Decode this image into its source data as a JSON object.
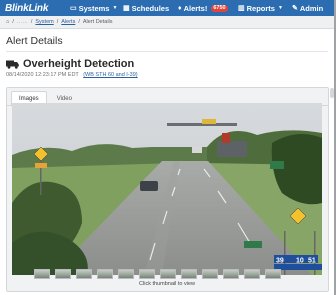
{
  "nav": {
    "brand": "BlinkLink",
    "systems": "Systems",
    "schedules": "Schedules",
    "alerts": "Alerts!",
    "alerts_count": "6750",
    "reports": "Reports",
    "admin": "Admin"
  },
  "breadcrumb": {
    "home": "⌂",
    "sep": "/",
    "system": "System",
    "alerts": "Alerts",
    "current": "Alert Details"
  },
  "page": {
    "title": "Alert Details"
  },
  "alert": {
    "title": "Overheight Detection",
    "timestamp": "08/14/2020 12:23:17 PM EDT",
    "location": "(WB STH 60 and I-39)"
  },
  "tabs": {
    "images": "Images",
    "video": "Video"
  },
  "signs": {
    "route_39": "39",
    "route_10": "10",
    "route_51": "51"
  },
  "thumbnails": {
    "count": 12
  },
  "hint": "Click thumbnail to view",
  "colors": {
    "navbar": "#2b6db0",
    "badge": "#e0453b",
    "link": "#2b5f9e"
  }
}
